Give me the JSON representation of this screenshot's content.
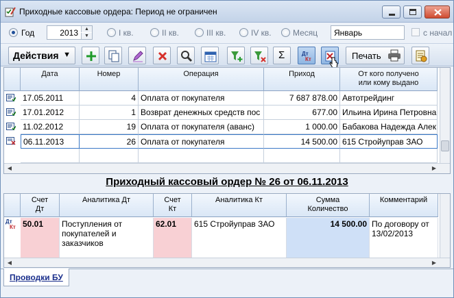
{
  "window": {
    "title": "Приходные кассовые ордера: Период не ограничен"
  },
  "period": {
    "year_label": "Год",
    "year_value": "2013",
    "q1_label": "I кв.",
    "q2_label": "II кв.",
    "q3_label": "III кв.",
    "q4_label": "IV кв.",
    "month_label": "Месяц",
    "month_value": "Январь",
    "from_start_label": "с начал"
  },
  "toolbar": {
    "actions_label": "Действия",
    "print_label": "Печать"
  },
  "orders_table": {
    "columns": {
      "date": "Дата",
      "number": "Номер",
      "operation": "Операция",
      "income": "Приход",
      "from_line1": "От кого получено",
      "from_line2": "или кому выдано"
    },
    "rows": [
      {
        "date": "17.05.2011",
        "number": "4",
        "operation": "Оплата от покупателя",
        "income": "7 687 878.00",
        "from": "Автотрейдинг"
      },
      {
        "date": "17.01.2012",
        "number": "1",
        "operation": "Возврат денежных средств пос",
        "income": "677.00",
        "from": "Ильина Ирина Петровна"
      },
      {
        "date": "11.02.2012",
        "number": "19",
        "operation": "Оплата от покупателя (аванс)",
        "income": "1 000.00",
        "from": "Бабакова Надежда Алек"
      },
      {
        "date": "06.11.2013",
        "number": "26",
        "operation": "Оплата от покупателя",
        "income": "14 500.00",
        "from": "615 Стройуправ ЗАО"
      }
    ]
  },
  "document": {
    "title": "Приходный кассовый ордер № 26 от 06.11.2013"
  },
  "postings_table": {
    "columns": {
      "debit_line1": "Счет",
      "debit_line2": "Дт",
      "analytics_dt": "Аналитика Дт",
      "credit_line1": "Счет",
      "credit_line2": "Кт",
      "analytics_kt": "Аналитика Кт",
      "sum_line1": "Сумма",
      "sum_line2": "Количество",
      "comment": "Комментарий"
    },
    "row": {
      "icon_dt": "Дт",
      "icon_kt": "Кт",
      "debit": "50.01",
      "analytics_dt": "Поступления от покупателей и заказчиков",
      "credit": "62.01",
      "analytics_kt": "615 Стройуправ ЗАО",
      "sum": "14 500.00",
      "comment": "По договору от 13/02/2013"
    }
  },
  "tabs": {
    "postings": "Проводки БУ"
  },
  "icons": [
    "checklist-pen-icon",
    "minimize-icon",
    "maximize-icon",
    "close-icon",
    "add-icon",
    "copy-icon",
    "edit-icon",
    "delete-icon",
    "search-icon",
    "calendar-icon",
    "filter-add-icon",
    "filter-remove-icon",
    "sigma-icon",
    "dt-kt-icon",
    "post-document-icon",
    "printer-icon",
    "report-icon"
  ],
  "colors": {
    "debit_cell": "#f8d0d4",
    "sum_cell": "#cfe0f7",
    "selection": "#3a78c6",
    "tab_link": "#1a2f8c"
  }
}
